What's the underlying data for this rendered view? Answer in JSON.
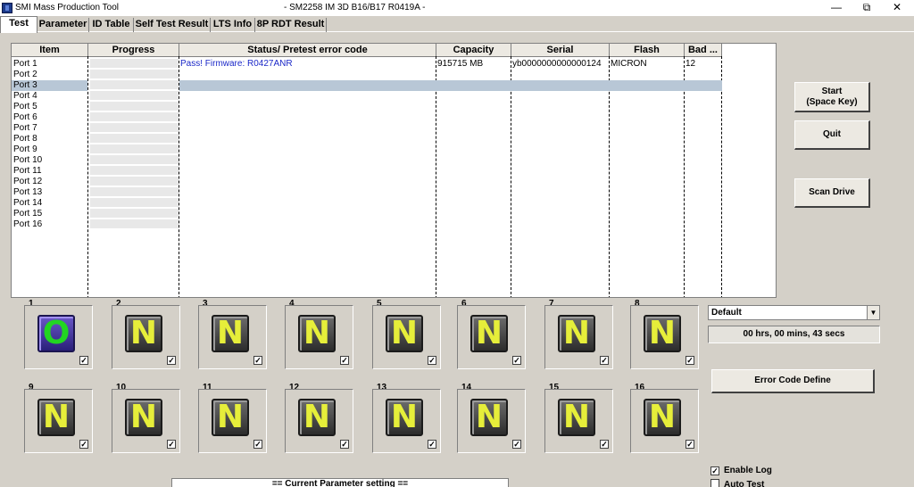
{
  "window": {
    "title_left": "SMI Mass Production Tool",
    "title_right": "- SM2258 IM 3D B16/B17 R0419A -",
    "minimize": "—",
    "restore": "⧉",
    "close": "✕"
  },
  "tabs": [
    "Test",
    "Parameter",
    "ID Table",
    "Self Test Result",
    "LTS Info",
    "8P RDT Result"
  ],
  "grid": {
    "columns": [
      "Item",
      "Progress",
      "Status/ Pretest error code",
      "Capacity",
      "Serial",
      "Flash",
      "Bad ..."
    ],
    "ports": [
      "Port 1",
      "Port 2",
      "Port 3",
      "Port 4",
      "Port 5",
      "Port 6",
      "Port 7",
      "Port 8",
      "Port 9",
      "Port 10",
      "Port 11",
      "Port 12",
      "Port 13",
      "Port 14",
      "Port 15",
      "Port 16"
    ],
    "row1": {
      "status": "Pass!  Firmware: R0427ANR",
      "capacity": "915715 MB",
      "serial": "yb0000000000000124",
      "flash": "MICRON",
      "bad": "12"
    }
  },
  "buttons": {
    "start": "Start\n(Space Key)",
    "quit": "Quit",
    "scan": "Scan Drive",
    "error_code": "Error Code Define"
  },
  "slots": [
    {
      "num": "1",
      "letter": "O",
      "checked": "✓"
    },
    {
      "num": "2",
      "letter": "N",
      "checked": "✓"
    },
    {
      "num": "3",
      "letter": "N",
      "checked": "✓"
    },
    {
      "num": "4",
      "letter": "N",
      "checked": "✓"
    },
    {
      "num": "5",
      "letter": "N",
      "checked": "✓"
    },
    {
      "num": "6",
      "letter": "N",
      "checked": "✓"
    },
    {
      "num": "7",
      "letter": "N",
      "checked": "✓"
    },
    {
      "num": "8",
      "letter": "N",
      "checked": "✓"
    },
    {
      "num": "9",
      "letter": "N",
      "checked": "✓"
    },
    {
      "num": "10",
      "letter": "N",
      "checked": "✓"
    },
    {
      "num": "11",
      "letter": "N",
      "checked": "✓"
    },
    {
      "num": "12",
      "letter": "N",
      "checked": "✓"
    },
    {
      "num": "13",
      "letter": "N",
      "checked": "✓"
    },
    {
      "num": "14",
      "letter": "N",
      "checked": "✓"
    },
    {
      "num": "15",
      "letter": "N",
      "checked": "✓"
    },
    {
      "num": "16",
      "letter": "N",
      "checked": "✓"
    }
  ],
  "combo": {
    "value": "Default",
    "arrow": "▼"
  },
  "timer": "00 hrs, 00 mins, 43 secs",
  "options": {
    "enable_log": {
      "label": "Enable Log",
      "mark": "✓"
    },
    "auto_test": {
      "label": "Auto Test",
      "mark": ""
    }
  },
  "param_setting": "== Current Parameter setting =="
}
